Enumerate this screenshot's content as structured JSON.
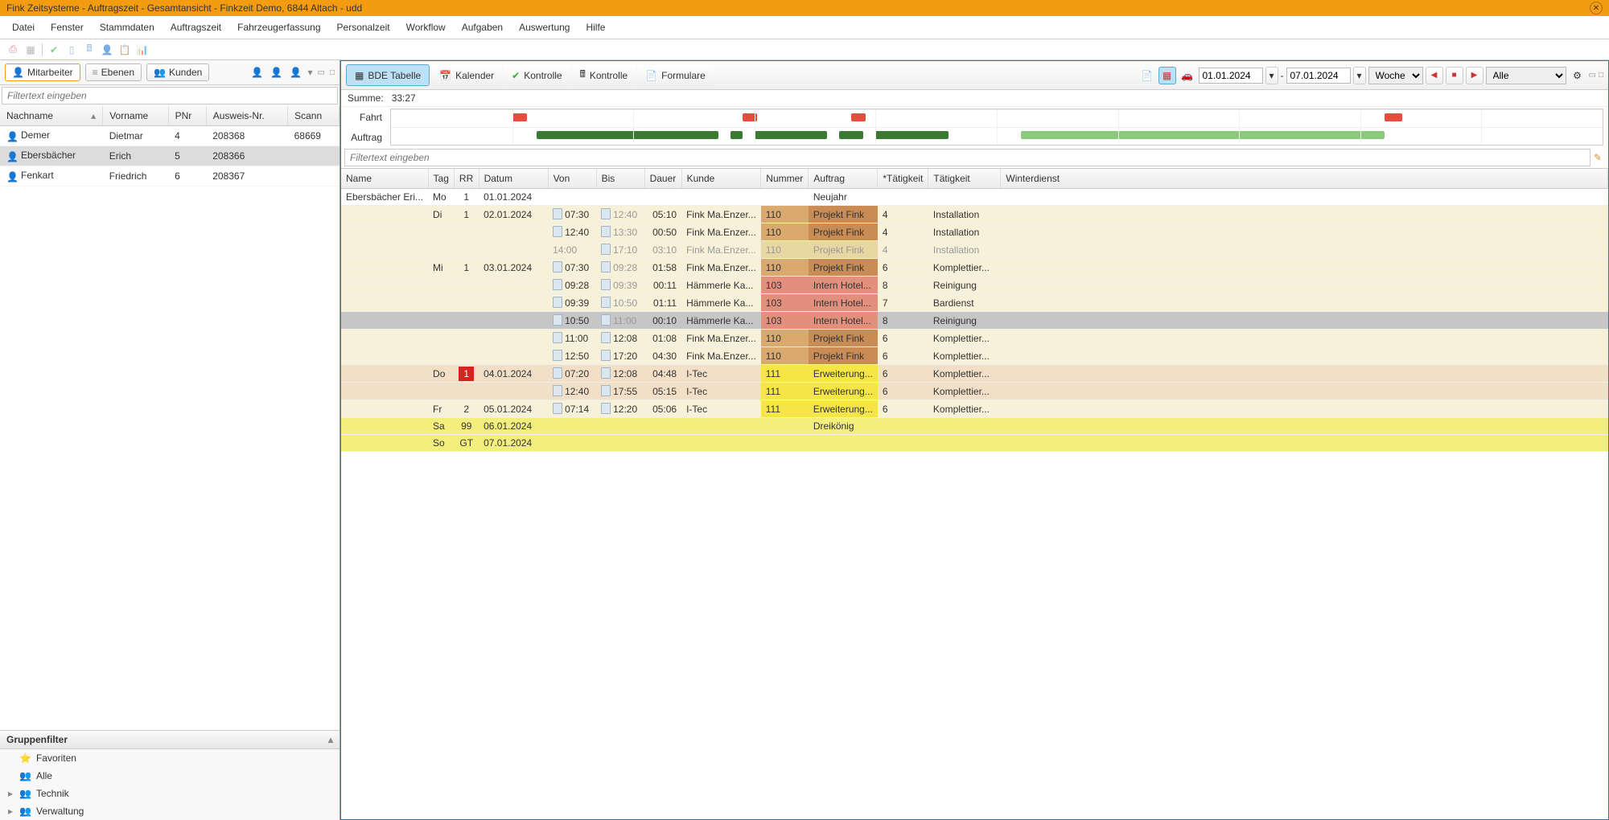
{
  "window": {
    "title": "Fink Zeitsysteme - Auftragszeit - Gesamtansicht - Finkzeit Demo, 6844 Altach - udd"
  },
  "menu": [
    "Datei",
    "Fenster",
    "Stammdaten",
    "Auftragszeit",
    "Fahrzeugerfassung",
    "Personalzeit",
    "Workflow",
    "Aufgaben",
    "Auswertung",
    "Hilfe"
  ],
  "leftPanel": {
    "tabs": {
      "mitarbeiter": "Mitarbeiter",
      "ebenen": "Ebenen",
      "kunden": "Kunden"
    },
    "filterPlaceholder": "Filtertext eingeben",
    "columns": [
      "Nachname",
      "Vorname",
      "PNr",
      "Ausweis-Nr.",
      "Scann"
    ],
    "employees": [
      {
        "nachname": "Demer",
        "vorname": "Dietmar",
        "pnr": "4",
        "ausweis": "208368",
        "scan": "68669",
        "selected": false
      },
      {
        "nachname": "Ebersbächer",
        "vorname": "Erich",
        "pnr": "5",
        "ausweis": "208366",
        "scan": "",
        "selected": true
      },
      {
        "nachname": "Fenkart",
        "vorname": "Friedrich",
        "pnr": "6",
        "ausweis": "208367",
        "scan": "",
        "selected": false
      }
    ],
    "groupFilter": {
      "title": "Gruppenfilter",
      "items": [
        "Favoriten",
        "Alle",
        "Technik",
        "Verwaltung"
      ]
    }
  },
  "rightPanel": {
    "tabs": [
      {
        "label": "BDE Tabelle",
        "active": true,
        "icon": "grid"
      },
      {
        "label": "Kalender",
        "active": false,
        "icon": "calendar"
      },
      {
        "label": "Kontrolle",
        "active": false,
        "icon": "check-green"
      },
      {
        "label": "Kontrolle",
        "active": false,
        "icon": "calc"
      },
      {
        "label": "Formulare",
        "active": false,
        "icon": "form"
      }
    ],
    "date1": "01.01.2024",
    "date2": "07.01.2024",
    "dash": "-",
    "period": "Woche",
    "periodOptions": [
      "Woche"
    ],
    "filterAll": "Alle",
    "summary": {
      "label": "Summe:",
      "value": "33:27"
    },
    "timeline": {
      "row1": "Fahrt",
      "row2": "Auftrag"
    },
    "filterPlaceholder": "Filtertext eingeben",
    "columns": [
      "Name",
      "Tag",
      "RR",
      "Datum",
      "Von",
      "Bis",
      "Dauer",
      "Kunde",
      "Nummer",
      "Auftrag",
      "*Tätigkeit",
      "Tätigkeit",
      "Winterdienst"
    ],
    "rows": [
      {
        "name": "Ebersbächer Eri...",
        "tag": "Mo",
        "rr": "1",
        "datum": "01.01.2024",
        "auftrag": "Neujahr",
        "rowcls": ""
      },
      {
        "tag": "Di",
        "rr": "1",
        "datum": "02.01.2024",
        "von": "07:30",
        "bis": "12:40",
        "bisgrey": true,
        "dauer": "05:10",
        "kunde": "Fink Ma.Enzer...",
        "nummer": "110",
        "numcls": "bg-brown",
        "auftrag": "Projekt Fink",
        "auftragcls": "bg-darkbrown",
        "tcode": "4",
        "taetigkeit": "Installation",
        "rowcls": "bg-cream"
      },
      {
        "von": "12:40",
        "bis": "13:30",
        "bisgrey": true,
        "dauer": "00:50",
        "kunde": "Fink Ma.Enzer...",
        "nummer": "110",
        "numcls": "bg-brown",
        "auftrag": "Projekt Fink",
        "auftragcls": "bg-darkbrown",
        "tcode": "4",
        "taetigkeit": "Installation",
        "rowcls": "bg-cream"
      },
      {
        "von": "14:00",
        "vongrey": true,
        "novonico": true,
        "bis": "17:10",
        "dauer": "03:10",
        "kunde": "Fink Ma.Enzer...",
        "nummer": "110",
        "numcls": "bg-faded",
        "auftrag": "Projekt Fink",
        "auftragcls": "bg-faded",
        "tcode": "4",
        "taetigkeit": "Installation",
        "rowcls": "bg-cream",
        "greyrow": true
      },
      {
        "tag": "Mi",
        "rr": "1",
        "datum": "03.01.2024",
        "von": "07:30",
        "bis": "09:28",
        "bisgrey": true,
        "dauer": "01:58",
        "kunde": "Fink Ma.Enzer...",
        "nummer": "110",
        "numcls": "bg-brown",
        "auftrag": "Projekt Fink",
        "auftragcls": "bg-darkbrown",
        "tcode": "6",
        "taetigkeit": "Komplettier...",
        "rowcls": "bg-cream"
      },
      {
        "von": "09:28",
        "bis": "09:39",
        "bisgrey": true,
        "dauer": "00:11",
        "kunde": "Hämmerle Ka...",
        "nummer": "103",
        "numcls": "bg-redish",
        "auftrag": "Intern Hotel...",
        "auftragcls": "bg-redish",
        "tcode": "8",
        "taetigkeit": "Reinigung",
        "rowcls": "bg-cream"
      },
      {
        "von": "09:39",
        "bis": "10:50",
        "bisgrey": true,
        "dauer": "01:11",
        "kunde": "Hämmerle Ka...",
        "nummer": "103",
        "numcls": "bg-redish",
        "auftrag": "Intern Hotel...",
        "auftragcls": "bg-redish",
        "tcode": "7",
        "taetigkeit": "Bardienst",
        "rowcls": "bg-cream"
      },
      {
        "von": "10:50",
        "bis": "11:00",
        "bisgrey": true,
        "dauer": "00:10",
        "kunde": "Hämmerle Ka...",
        "nummer": "103",
        "numcls": "bg-redish",
        "auftrag": "Intern Hotel...",
        "auftragcls": "bg-redish",
        "tcode": "8",
        "taetigkeit": "Reinigung",
        "rowcls": "bg-greyrow"
      },
      {
        "von": "11:00",
        "bis": "12:08",
        "dauer": "01:08",
        "kunde": "Fink Ma.Enzer...",
        "nummer": "110",
        "numcls": "bg-brown",
        "auftrag": "Projekt Fink",
        "auftragcls": "bg-darkbrown",
        "tcode": "6",
        "taetigkeit": "Komplettier...",
        "rowcls": "bg-cream"
      },
      {
        "von": "12:50",
        "bis": "17:20",
        "dauer": "04:30",
        "kunde": "Fink Ma.Enzer...",
        "nummer": "110",
        "numcls": "bg-brown",
        "auftrag": "Projekt Fink",
        "auftragcls": "bg-darkbrown",
        "tcode": "6",
        "taetigkeit": "Komplettier...",
        "rowcls": "bg-cream"
      },
      {
        "tag": "Do",
        "rr": "1",
        "rrred": true,
        "datum": "04.01.2024",
        "von": "07:20",
        "bis": "12:08",
        "dauer": "04:48",
        "kunde": "I-Tec",
        "nummer": "111",
        "numcls": "bg-yellow",
        "auftrag": "Erweiterung...",
        "auftragcls": "bg-yellow",
        "tcode": "6",
        "taetigkeit": "Komplettier...",
        "rowcls": "bg-pinkish"
      },
      {
        "von": "12:40",
        "bis": "17:55",
        "dauer": "05:15",
        "kunde": "I-Tec",
        "nummer": "111",
        "numcls": "bg-yellow",
        "auftrag": "Erweiterung...",
        "auftragcls": "bg-yellow",
        "tcode": "6",
        "taetigkeit": "Komplettier...",
        "rowcls": "bg-pinkish"
      },
      {
        "tag": "Fr",
        "rr": "2",
        "datum": "05.01.2024",
        "von": "07:14",
        "bis": "12:20",
        "dauer": "05:06",
        "kunde": "I-Tec",
        "nummer": "111",
        "numcls": "bg-yellow",
        "auftrag": "Erweiterung...",
        "auftragcls": "bg-yellow",
        "tcode": "6",
        "taetigkeit": "Komplettier...",
        "rowcls": "bg-cream"
      },
      {
        "tag": "Sa",
        "rr": "99",
        "datum": "06.01.2024",
        "auftrag": "Dreikönig",
        "rowcls": "bg-yellowrow"
      },
      {
        "tag": "So",
        "rr": "GT",
        "datum": "07.01.2024",
        "rowcls": "bg-yellowrow"
      }
    ]
  }
}
